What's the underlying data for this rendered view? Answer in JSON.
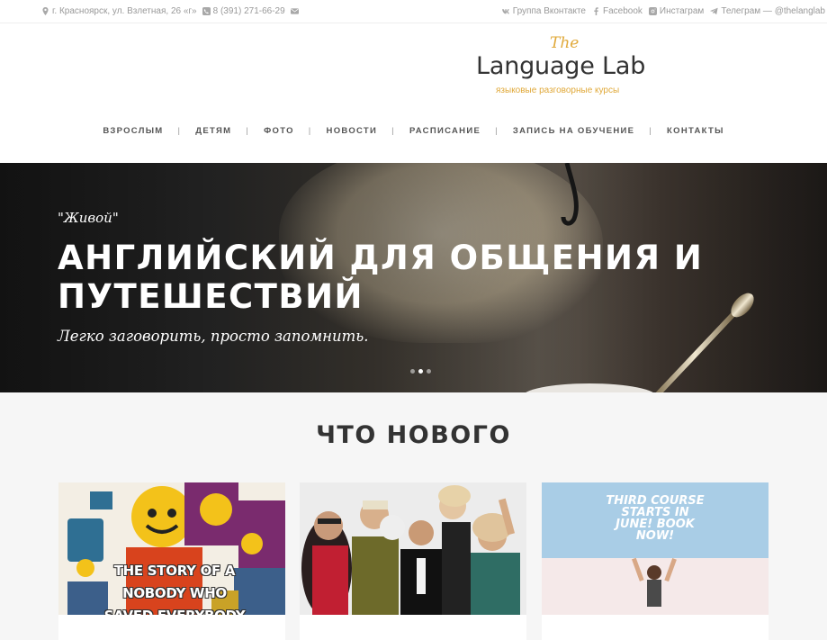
{
  "topbar": {
    "address": "г. Красноярск, ул. Взлетная, 26 «г»",
    "phone": "8 (391) 271-66-29",
    "social": [
      {
        "label": "Группа Вконтакте",
        "icon": "vk-icon"
      },
      {
        "label": "Facebook",
        "icon": "facebook-icon"
      },
      {
        "label": "Инстаграм",
        "icon": "instagram-icon"
      },
      {
        "label": "Телеграм — @thelanglab",
        "icon": "telegram-icon"
      }
    ]
  },
  "logo": {
    "the": "The",
    "name": "Language Lab",
    "subtitle": "языковые разговорные курсы",
    "accent_color": "#e0a93a"
  },
  "nav": {
    "items": [
      "ВЗРОСЛЫМ",
      "ДЕТЯМ",
      "ФОТО",
      "НОВОСТИ",
      "РАСПИСАНИЕ",
      "ЗАПИСЬ НА ОБУЧЕНИЕ",
      "КОНТАКТЫ"
    ]
  },
  "hero": {
    "kicker": "\"Живой\"",
    "title": "АНГЛИЙСКИЙ ДЛЯ ОБЩЕНИЯ И ПУТЕШЕСТВИЙ",
    "tagline": "Легко заговорить, просто запомнить.",
    "slides": 3,
    "active_slide": 2
  },
  "news": {
    "title": "ЧТО НОВОГО",
    "cards": [
      {
        "image_text": "THE STORY OF A NOBODY WHO SAVED EVERYBODY"
      },
      {
        "image_text": ""
      },
      {
        "image_text": "THIRD COURSE STARTS IN JUNE! BOOK NOW!"
      }
    ]
  }
}
